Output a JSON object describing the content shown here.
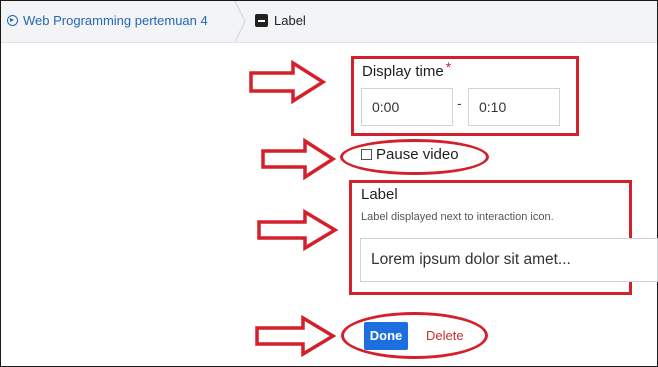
{
  "breadcrumb": {
    "course_link": "Web Programming pertemuan 4",
    "current": "Label",
    "course_icon": "play-circle-icon",
    "current_icon": "label-icon"
  },
  "form": {
    "display_time_label": "Display time",
    "required_mark": "*",
    "start_time": "0:00",
    "time_separator": "-",
    "end_time": "0:10",
    "pause_video_label": "Pause video",
    "pause_video_checked": false,
    "label_title": "Label",
    "label_help": "Label displayed next to interaction icon.",
    "label_value": "Lorem ipsum dolor sit amet..."
  },
  "actions": {
    "done": "Done",
    "delete": "Delete"
  },
  "annotation_colors": {
    "highlight": "#d3202a",
    "accent": "#1d6fe0"
  }
}
